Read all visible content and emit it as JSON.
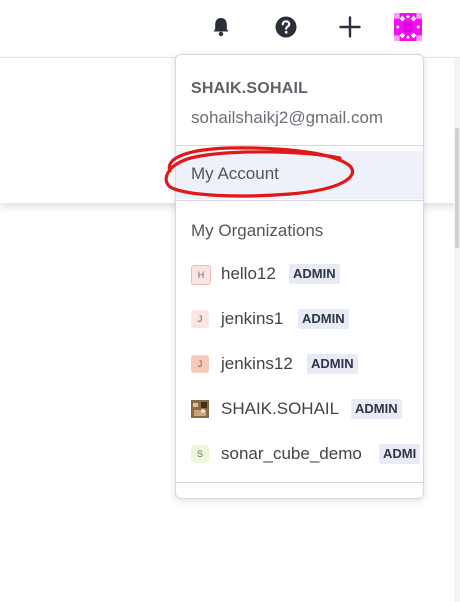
{
  "topbar": {
    "icons": [
      "bell-icon",
      "help-icon",
      "plus-icon",
      "user-avatar"
    ],
    "avatar_color": "#f00ff0"
  },
  "account_menu": {
    "username": "SHAIK.SOHAIL",
    "email": "sohailshaikj2@gmail.com",
    "my_account_label": "My Account",
    "organizations_title": "My Organizations",
    "organizations": [
      {
        "initial": "H",
        "name": "hello12",
        "role": "ADMIN",
        "avatar_color": "#fde4e4"
      },
      {
        "initial": "J",
        "name": "jenkins1",
        "role": "ADMIN",
        "avatar_color": "#fde4e4"
      },
      {
        "initial": "J",
        "name": "jenkins12",
        "role": "ADMIN",
        "avatar_color": "#f6c9b8"
      },
      {
        "initial": "",
        "name": "SHAIK.SOHAIL",
        "role": "ADMIN",
        "avatar_color": "#8a6a48"
      },
      {
        "initial": "S",
        "name": "sonar_cube_demo",
        "role": "ADMI",
        "avatar_color": "#eef7d9"
      }
    ]
  },
  "colors": {
    "highlight_bg": "#eef1fa",
    "badge_bg": "#e8ebf5",
    "annotation_red": "#e01818"
  }
}
